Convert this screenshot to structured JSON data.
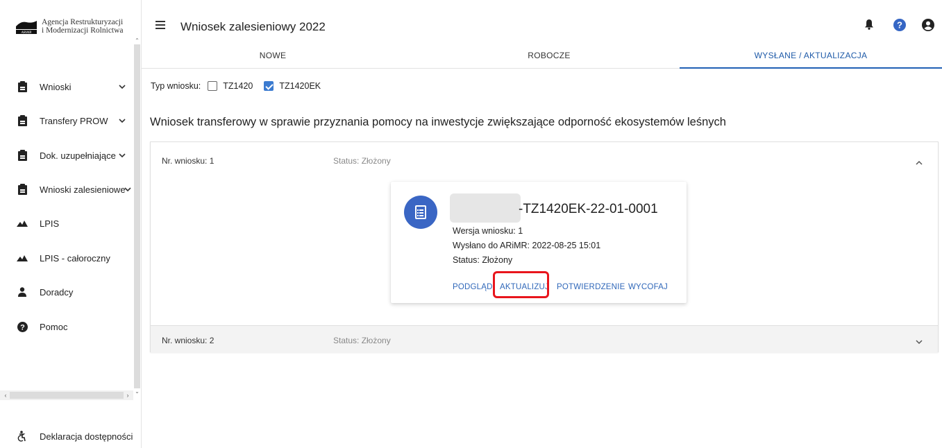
{
  "logo": {
    "line1": "Agencja Restrukturyzacji",
    "line2": "i Modernizacji Rolnictwa",
    "mark_text": "ARiMR"
  },
  "sidebar": {
    "items": [
      {
        "label": "Wnioski",
        "icon": "clipboard-icon",
        "expandable": true
      },
      {
        "label": "Transfery PROW",
        "icon": "clipboard-icon",
        "expandable": true
      },
      {
        "label": "Dok. uzupełniające",
        "icon": "clipboard-icon",
        "expandable": true
      },
      {
        "label": "Wnioski zalesieniowe",
        "icon": "clipboard-icon",
        "expandable": true
      },
      {
        "label": "LPIS",
        "icon": "terrain-icon",
        "expandable": false
      },
      {
        "label": "LPIS - całoroczny",
        "icon": "terrain-icon",
        "expandable": false
      },
      {
        "label": "Doradcy",
        "icon": "person-icon",
        "expandable": false
      },
      {
        "label": "Pomoc",
        "icon": "help-icon",
        "expandable": false
      }
    ],
    "chevron": "⌄",
    "footer": {
      "label": "Deklaracja dostępności",
      "icon": "accessibility-icon"
    }
  },
  "header": {
    "title": "Wniosek zalesieniowy 2022",
    "icons": [
      "bell-icon",
      "help-icon",
      "account-icon"
    ]
  },
  "tabs": [
    {
      "label": "NOWE",
      "active": false
    },
    {
      "label": "ROBOCZE",
      "active": false
    },
    {
      "label": "WYSŁANE / AKTUALIZACJA",
      "active": true
    }
  ],
  "filter": {
    "label": "Typ wniosku:",
    "options": [
      {
        "label": "TZ1420",
        "checked": false
      },
      {
        "label": "TZ1420EK",
        "checked": true
      }
    ]
  },
  "section_title": "Wniosek transferowy w sprawie przyznania pomocy na inwestycje zwiększające odporność ekosystemów leśnych",
  "applications": [
    {
      "number": "Nr. wniosku: 1",
      "status": "Status: Złożony",
      "expanded": true,
      "card": {
        "id_suffix": "-TZ1420EK-22-01-0001",
        "version": "Wersja wniosku: 1",
        "sent": "Wysłano do ARiMR: 2022-08-25 15:01",
        "status": "Status: Złożony",
        "actions": [
          "PODGLĄD",
          "AKTUALIZUJ",
          "POTWIERDZENIE",
          "WYCOFAJ"
        ],
        "highlighted_action": "AKTUALIZUJ"
      }
    },
    {
      "number": "Nr. wniosku: 2",
      "status": "Status: Złożony",
      "expanded": false
    }
  ],
  "colors": {
    "accent": "#2060b5",
    "avatar": "#3a66c4",
    "highlight": "#e8151c"
  }
}
